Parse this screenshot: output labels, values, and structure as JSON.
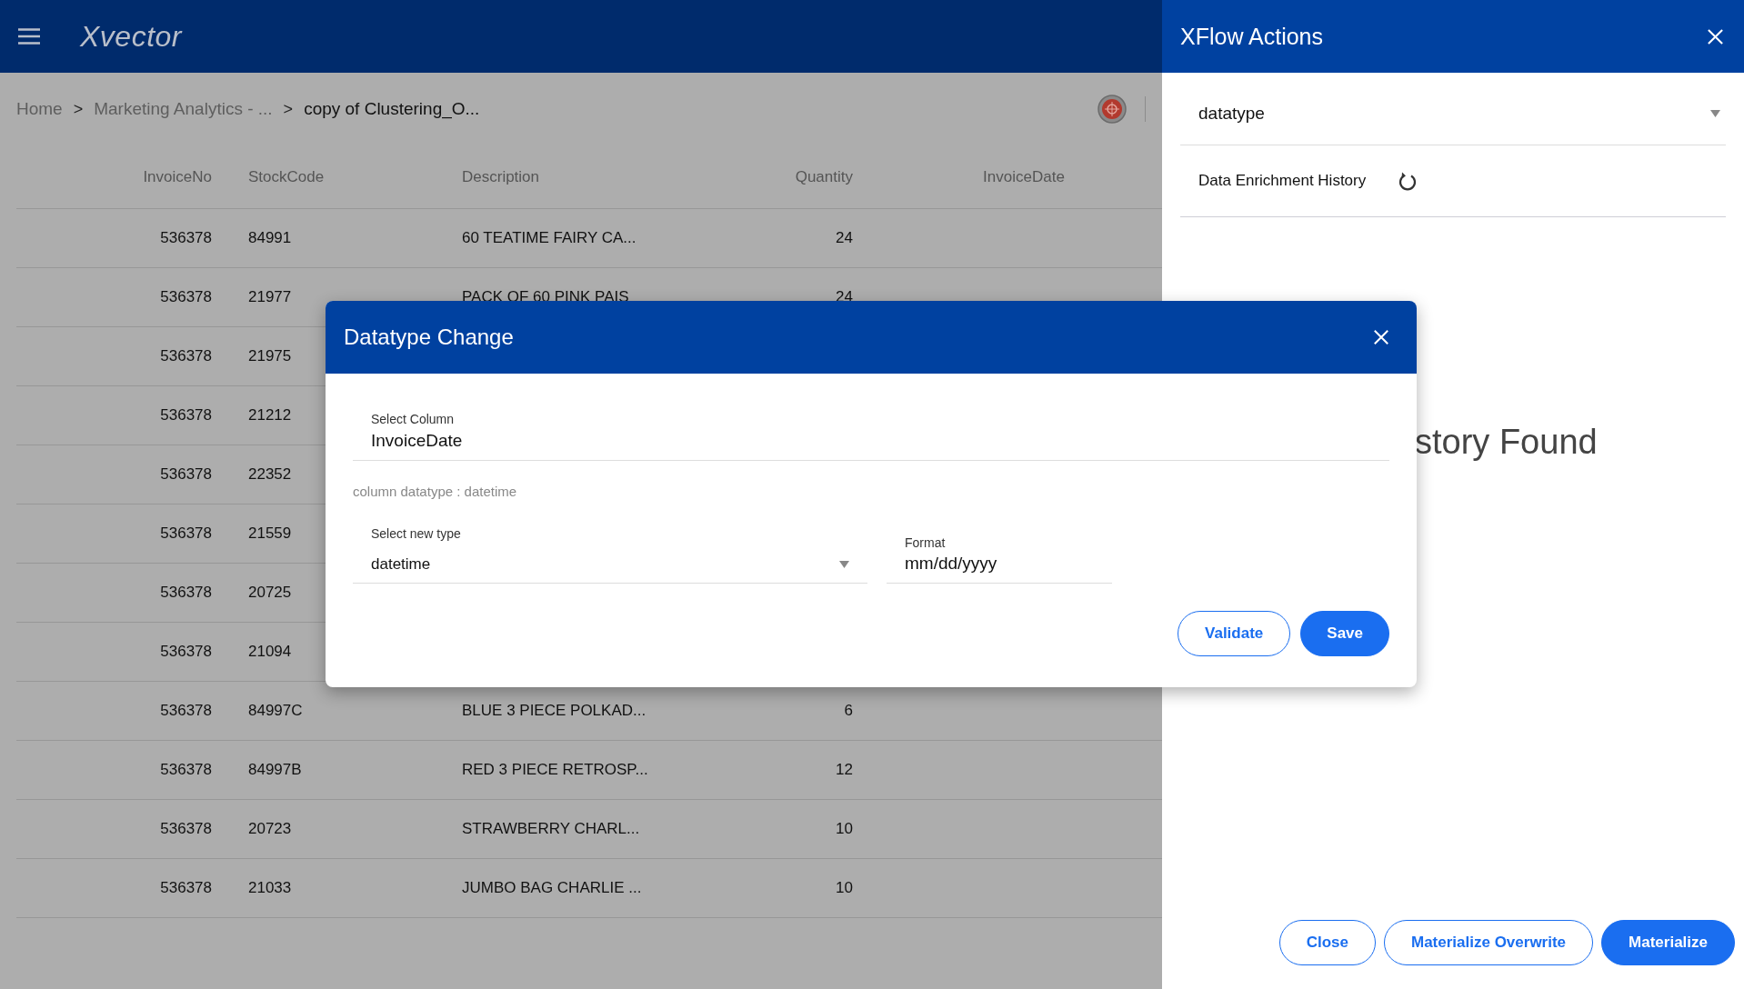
{
  "header": {
    "logo": "Xvector"
  },
  "breadcrumb": {
    "separator": ">",
    "items": [
      {
        "label": "Home",
        "current": false
      },
      {
        "label": "Marketing Analytics - ...",
        "current": false
      },
      {
        "label": "copy of Clustering_O...",
        "current": true
      }
    ]
  },
  "table": {
    "columns": [
      "InvoiceNo",
      "StockCode",
      "Description",
      "Quantity",
      "InvoiceDate"
    ],
    "rows": [
      {
        "cells": [
          "536378",
          "84991",
          "60 TEATIME FAIRY CA...",
          "24"
        ]
      },
      {
        "cells": [
          "536378",
          "21977",
          "PACK OF 60 PINK PAIS",
          "24"
        ]
      },
      {
        "cells": [
          "536378",
          "21975"
        ]
      },
      {
        "cells": [
          "536378",
          "21212"
        ]
      },
      {
        "cells": [
          "536378",
          "22352"
        ]
      },
      {
        "cells": [
          "536378",
          "21559"
        ]
      },
      {
        "cells": [
          "536378",
          "20725"
        ]
      },
      {
        "cells": [
          "536378",
          "21094"
        ]
      },
      {
        "cells": [
          "536378",
          "84997C",
          "BLUE 3 PIECE POLKAD...",
          "6"
        ]
      },
      {
        "cells": [
          "536378",
          "84997B",
          "RED 3 PIECE RETROSP...",
          "12"
        ]
      },
      {
        "cells": [
          "536378",
          "20723",
          "STRAWBERRY CHARL...",
          "10"
        ]
      },
      {
        "cells": [
          "536378",
          "21033",
          "JUMBO BAG CHARLIE ...",
          "10"
        ]
      }
    ]
  },
  "panel": {
    "title": "XFlow Actions",
    "action_select": {
      "value": "datatype"
    },
    "history_label": "Data Enrichment History",
    "empty_message": "story Found",
    "buttons": [
      {
        "label": "Close",
        "primary": false
      },
      {
        "label": "Materialize Overwrite",
        "primary": false
      },
      {
        "label": "Materialize",
        "primary": true
      }
    ]
  },
  "dialog": {
    "title": "Datatype Change",
    "column_field": {
      "label": "Select Column",
      "value": "InvoiceDate"
    },
    "hint": "column datatype : datetime",
    "type_select": {
      "label": "Select new type",
      "value": "datetime"
    },
    "format_field": {
      "label": "Format",
      "value": "mm/dd/yyyy"
    },
    "buttons": [
      {
        "label": "Validate",
        "primary": false
      },
      {
        "label": "Save",
        "primary": true
      }
    ]
  }
}
